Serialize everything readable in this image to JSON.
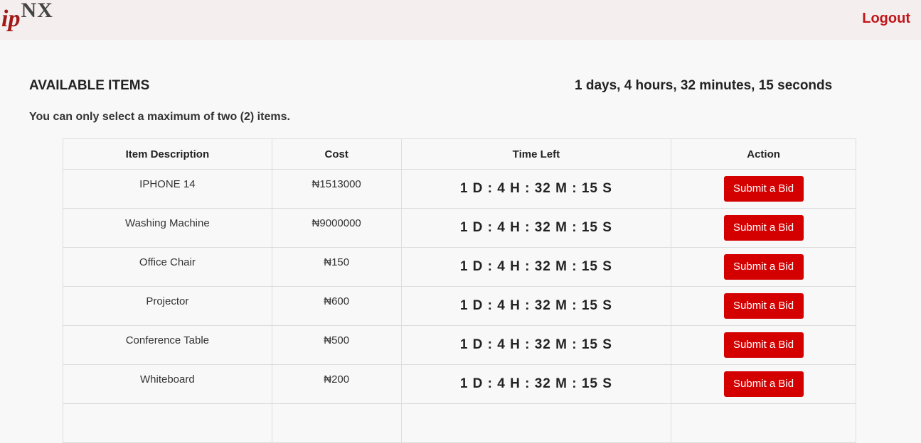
{
  "header": {
    "logo_ip": "ip",
    "logo_nx": "NX",
    "logout_label": "Logout",
    "background": "#f5eeee",
    "accent": "#c0161a"
  },
  "main": {
    "title": "AVAILABLE ITEMS",
    "countdown": "1 days, 4 hours, 32 minutes, 15 seconds",
    "notice": "You can only select a maximum of two (2) items."
  },
  "table": {
    "columns": [
      "Item Description",
      "Cost",
      "Time Left",
      "Action"
    ],
    "rows": [
      {
        "description": "IPHONE 14",
        "cost": "₦1513000",
        "time_left": "1 D : 4 H : 32 M : 15 S",
        "action": "Submit a Bid"
      },
      {
        "description": "Washing Machine",
        "cost": "₦9000000",
        "time_left": "1 D : 4 H : 32 M : 15 S",
        "action": "Submit a Bid"
      },
      {
        "description": "Office Chair",
        "cost": "₦150",
        "time_left": "1 D : 4 H : 32 M : 15 S",
        "action": "Submit a Bid"
      },
      {
        "description": "Projector",
        "cost": "₦600",
        "time_left": "1 D : 4 H : 32 M : 15 S",
        "action": "Submit a Bid"
      },
      {
        "description": "Conference Table",
        "cost": "₦500",
        "time_left": "1 D : 4 H : 32 M : 15 S",
        "action": "Submit a Bid"
      },
      {
        "description": "Whiteboard",
        "cost": "₦200",
        "time_left": "1 D : 4 H : 32 M : 15 S",
        "action": "Submit a Bid"
      }
    ]
  },
  "colors": {
    "button": "#d40000",
    "button_text": "#ffffff",
    "page_background": "#f8f8f8"
  }
}
